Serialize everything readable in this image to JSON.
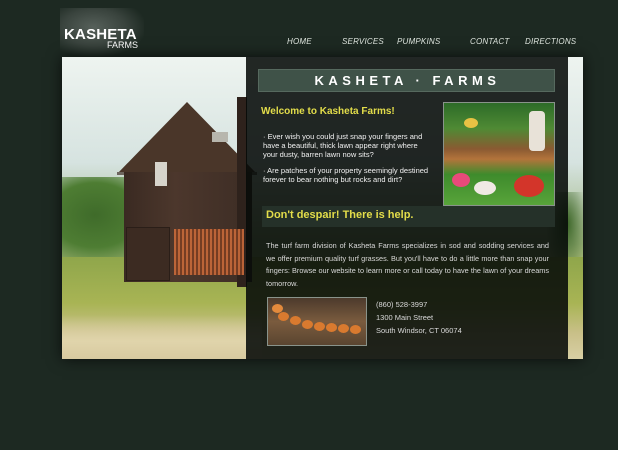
{
  "logo": {
    "main": "KASHETA",
    "sub": "FARMS"
  },
  "nav": [
    {
      "label": "HOME"
    },
    {
      "label": "SERVICES"
    },
    {
      "label": "PUMPKINS"
    },
    {
      "label": "CONTACT"
    },
    {
      "label": "DIRECTIONS"
    }
  ],
  "banner": {
    "title": "KASHETA · FARMS"
  },
  "welcome": {
    "heading": "Welcome to Kasheta Farms!",
    "bullets": [
      "· Ever wish you could just snap your fingers and have a beautiful, thick lawn appear right where your dusty, barren lawn now sits?",
      "· Are patches of your property seemingly destined forever to bear nothing but rocks and dirt?"
    ]
  },
  "despair": {
    "heading": "Don't despair! There is help."
  },
  "intro": {
    "text": "The turf farm division of Kasheta Farms specializes in sod and sodding services and we offer premium quality turf grasses. But you'll have to do a little more than snap your fingers: Browse our website to learn more or call today to have the lawn of your dreams tomorrow."
  },
  "contact": {
    "phone": "(860) 528-3997",
    "street": "1300 Main Street",
    "city": "South Windsor, CT 06074"
  },
  "colors": {
    "background": "#1d2922",
    "accent_yellow": "#e3dd4a",
    "title_bar": "#3f5248",
    "overlay": "#060a08"
  },
  "icons": {
    "barn_photo": "barn-photo",
    "garden_photo": "garden-photo",
    "pumpkin_photo": "pumpkin-photo"
  }
}
